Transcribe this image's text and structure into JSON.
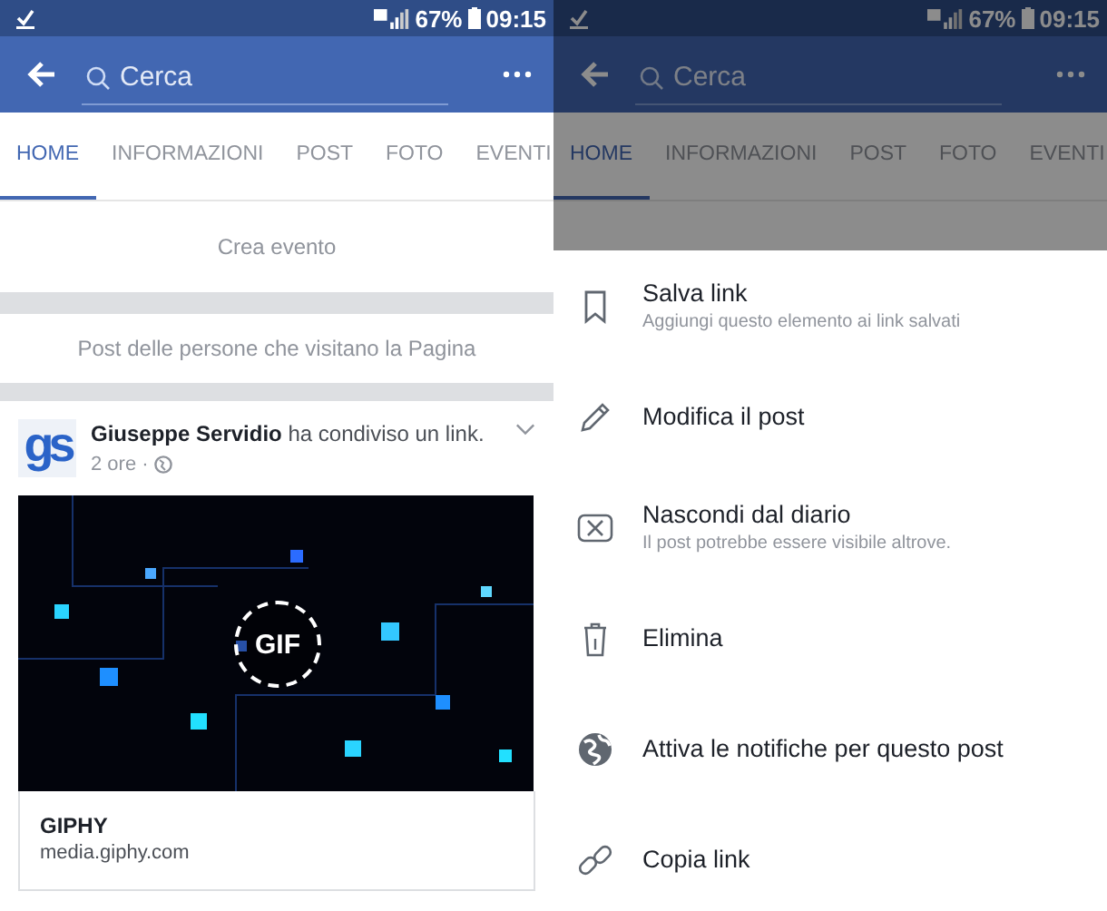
{
  "screens": [
    {
      "kind": "page",
      "dimmed": false,
      "status_bar": {
        "battery": "67%",
        "time": "09:15"
      },
      "search": {
        "placeholder": "Cerca"
      },
      "tabs": [
        {
          "label": "HOME",
          "selected": true
        },
        {
          "label": "INFORMAZIONI",
          "selected": false
        },
        {
          "label": "POST",
          "selected": false
        },
        {
          "label": "FOTO",
          "selected": false
        },
        {
          "label": "EVENTI",
          "selected": false
        }
      ],
      "sections": [
        "Crea evento",
        "Post delle persone che visitano la Pagina"
      ],
      "post": {
        "avatar": "gs",
        "author": "Giuseppe Servidio",
        "action": "ha condiviso un link.",
        "time": "2 ore ·",
        "badge": "GIF",
        "link_title": "GIPHY",
        "link_domain": "media.giphy.com"
      }
    },
    {
      "kind": "menu",
      "dimmed": true,
      "status_bar": {
        "battery": "67%",
        "time": "09:15"
      },
      "search": {
        "placeholder": "Cerca"
      },
      "tabs": [
        {
          "label": "HOME",
          "selected": true
        },
        {
          "label": "INFORMAZIONI",
          "selected": false
        },
        {
          "label": "POST",
          "selected": false
        },
        {
          "label": "FOTO",
          "selected": false
        },
        {
          "label": "EVENTI",
          "selected": false
        }
      ],
      "menu": [
        {
          "title": "Salva link",
          "subtitle": "Aggiungi questo elemento ai link salvati"
        },
        {
          "title": "Modifica il post"
        },
        {
          "title": "Nascondi dal diario",
          "subtitle": "Il post potrebbe essere visibile altrove."
        },
        {
          "title": "Elimina"
        },
        {
          "title": "Attiva le notifiche per questo post"
        },
        {
          "title": "Copia link"
        }
      ]
    }
  ]
}
